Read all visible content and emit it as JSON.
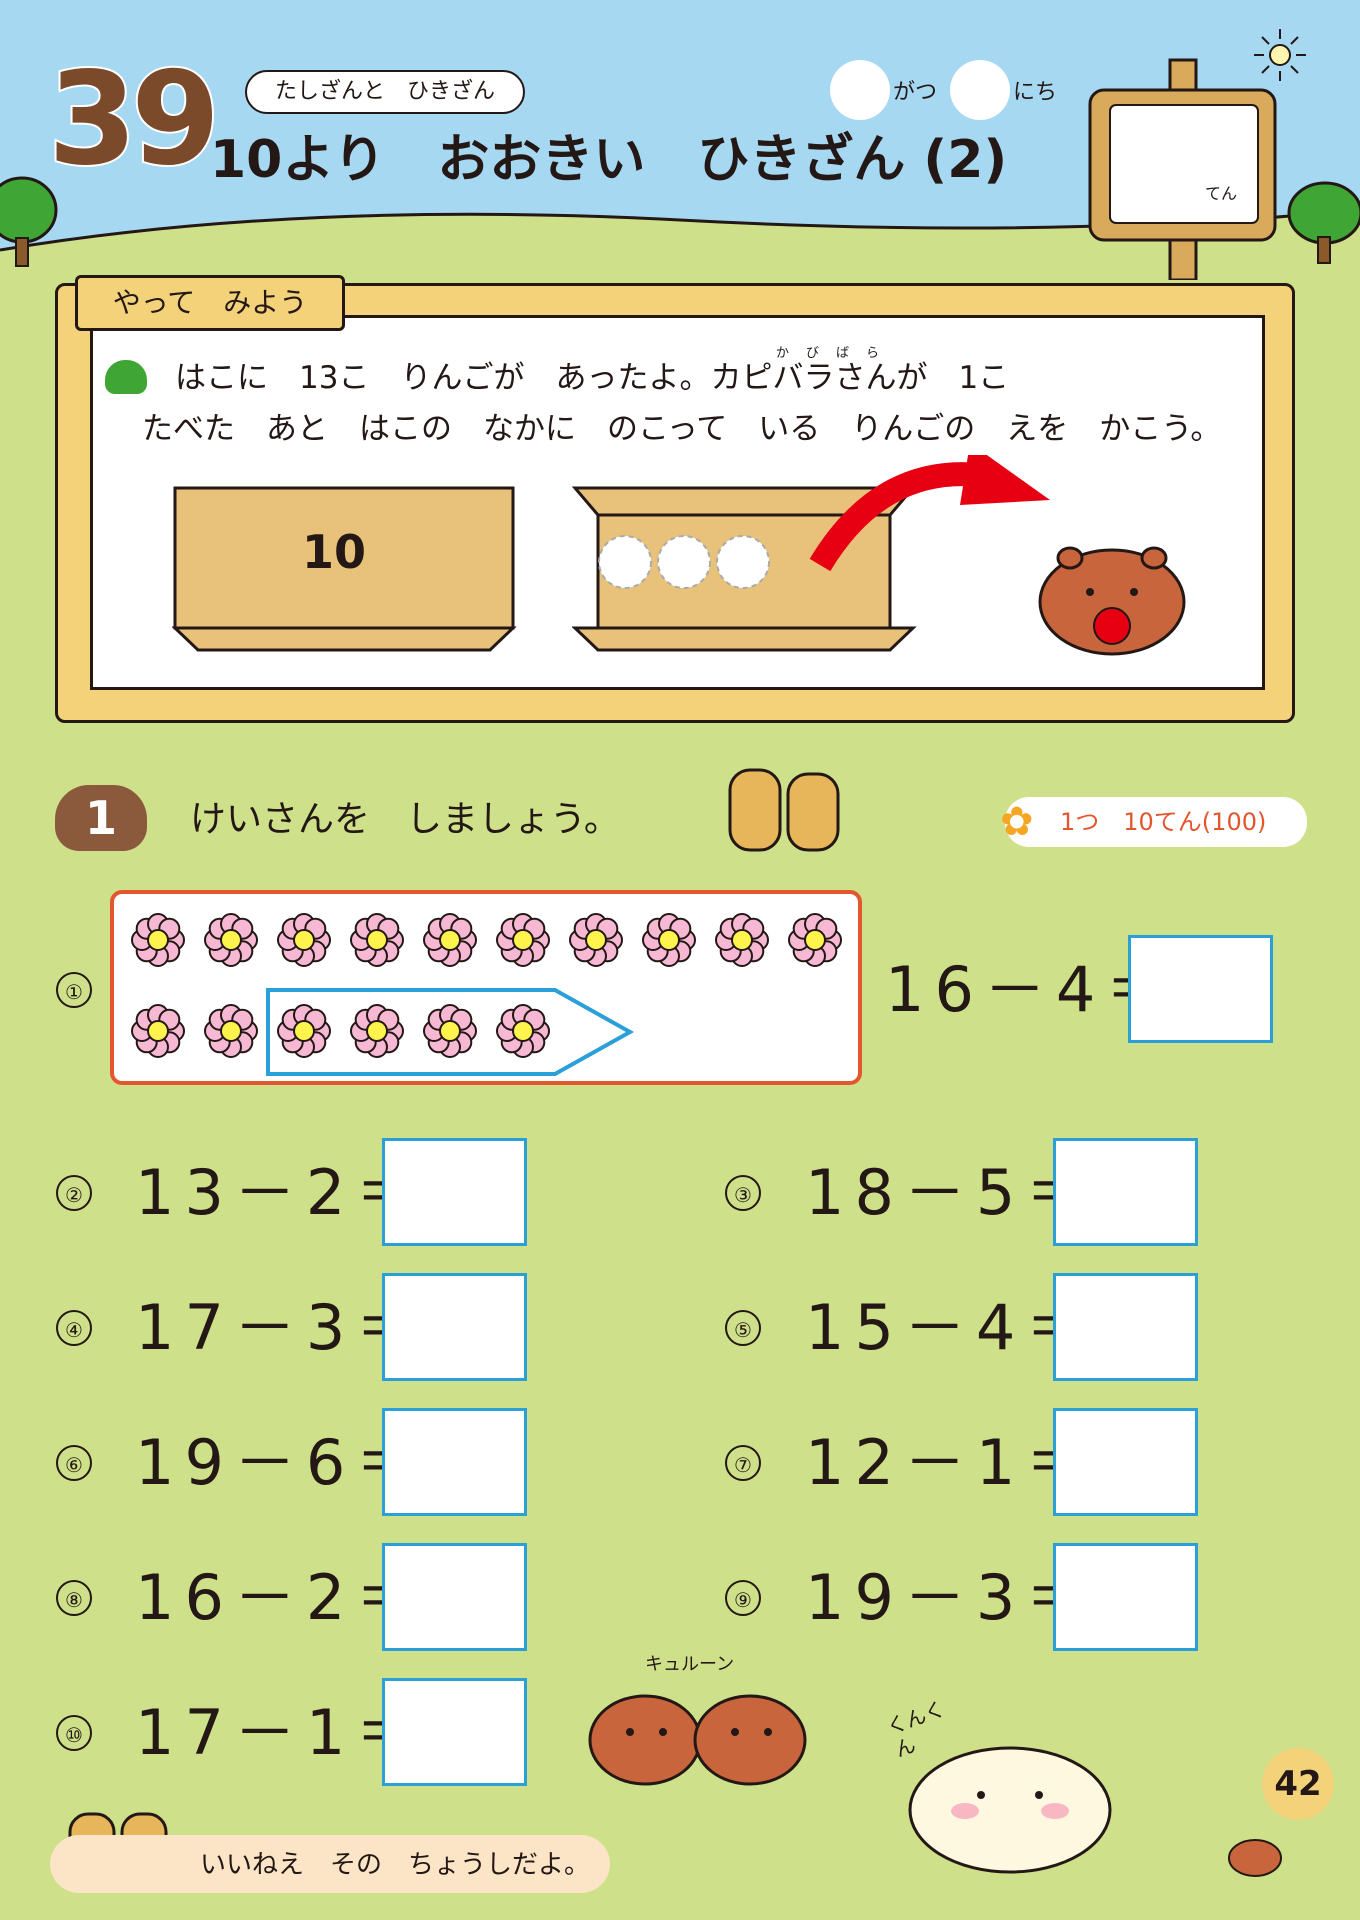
{
  "header": {
    "lesson_number": "39",
    "category": "たしざんと　ひきざん",
    "title": "10より　おおきい　ひきざん (2)",
    "month_label": "がつ",
    "day_label": "にち",
    "score_label": "てん"
  },
  "intro": {
    "tag": "やって　みよう",
    "text_line1": "はこに　13こ　りんごが　あったよ。カピバラさんが　1こ",
    "text_line2": "たべた　あと　はこの　なかに　のこって　いる　りんごの　えを　かこう。",
    "ruby": "かびばら",
    "full_box_label": "10"
  },
  "section1": {
    "number": "1",
    "instruction": "けいさんを　しましょう。",
    "points": "1つ　10てん(100)"
  },
  "problems": [
    {
      "label": "①",
      "expr": "16－4＝"
    },
    {
      "label": "②",
      "expr": "13－2＝"
    },
    {
      "label": "③",
      "expr": "18－5＝"
    },
    {
      "label": "④",
      "expr": "17－3＝"
    },
    {
      "label": "⑤",
      "expr": "15－4＝"
    },
    {
      "label": "⑥",
      "expr": "19－6＝"
    },
    {
      "label": "⑦",
      "expr": "12－1＝"
    },
    {
      "label": "⑧",
      "expr": "16－2＝"
    },
    {
      "label": "⑨",
      "expr": "19－3＝"
    },
    {
      "label": "⑩",
      "expr": "17－1＝"
    }
  ],
  "decor": {
    "sound_effect": "キュルーン",
    "sound_kun": "くんくん"
  },
  "footer": {
    "message": "いいねえ　その　ちょうしだよ。",
    "page_number": "42"
  },
  "colors": {
    "sky": "#a6d8f2",
    "grass": "#cfe08a",
    "answer_box_border": "#2a9fd8",
    "flower_box_border": "#e4572e",
    "wood": "#f3d27a",
    "lesson_number": "#7a4a2a"
  }
}
